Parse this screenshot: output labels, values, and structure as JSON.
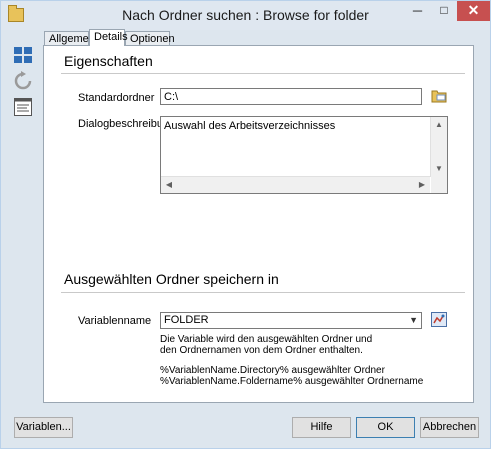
{
  "window": {
    "title": "Nach Ordner suchen : Browse for folder",
    "minimize": "─",
    "maximize": "□",
    "close": "✕"
  },
  "tabs": [
    {
      "label": "Allgemein"
    },
    {
      "label": "Details"
    },
    {
      "label": "Optionen"
    }
  ],
  "active_tab": "Details",
  "sidebar": {
    "icons": [
      "windows-tiles-icon",
      "refresh-icon",
      "properties-icon"
    ]
  },
  "section_properties": {
    "title": "Eigenschaften",
    "default_folder_label": "Standardordner",
    "default_folder_value": "C:\\",
    "description_label": "Dialogbeschreibung",
    "description_value": "Auswahl des Arbeitsverzeichnisses"
  },
  "section_save": {
    "title": "Ausgewählten Ordner speichern in",
    "variable_label": "Variablenname",
    "variable_value": "FOLDER",
    "info_line1": "Die Variable wird den ausgewählten Ordner und",
    "info_line2": "den Ordnernamen von dem Ordner enthalten.",
    "info_line3": "%VariablenName.Directory% ausgewählter Ordner",
    "info_line4": "%VariablenName.Foldername% ausgewählter Ordnername"
  },
  "buttons": {
    "variables": "Variablen...",
    "help": "Hilfe",
    "ok": "OK",
    "cancel": "Abbrechen"
  },
  "colors": {
    "accent": "#3c7fb1",
    "close": "#c75050"
  }
}
